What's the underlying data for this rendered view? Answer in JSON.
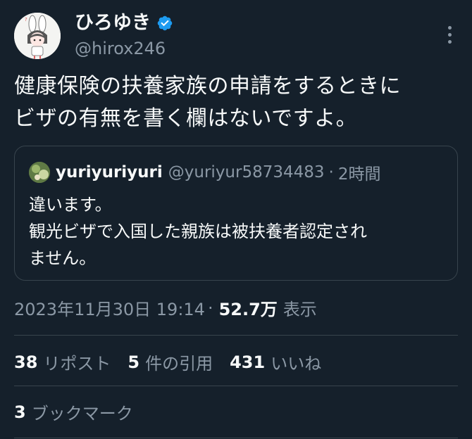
{
  "author": {
    "display_name": "ひろゆき",
    "handle": "@hirox246",
    "verified": true,
    "avatar_icon": "rabbit-illustration-avatar"
  },
  "tweet": {
    "lines": [
      "健康保険の扶養家族の申請をするときに",
      "ビザの有無を書く欄はないですよ。"
    ]
  },
  "quote": {
    "display_name": "yuriyuriyuri",
    "handle": "@yuriyur58734483",
    "separator": "·",
    "time": "2時間",
    "lines": [
      "違います。",
      "観光ビザで入国した親族は被扶養者認定され",
      "ません。"
    ]
  },
  "meta": {
    "timestamp": "2023年11月30日 19:14",
    "separator": "·",
    "views": "52.7万",
    "views_label": "表示"
  },
  "stats": {
    "reposts_count": "38",
    "reposts_label": "リポスト",
    "quotes_count": "5",
    "quotes_label": "件の引用",
    "likes_count": "431",
    "likes_label": "いいね"
  },
  "bookmarks": {
    "count": "3",
    "label": "ブックマーク"
  },
  "colors": {
    "background": "#15202b",
    "text": "#f7f9f9",
    "secondary": "#8b98a5",
    "border": "#38444d",
    "verified": "#1d9bf0"
  }
}
